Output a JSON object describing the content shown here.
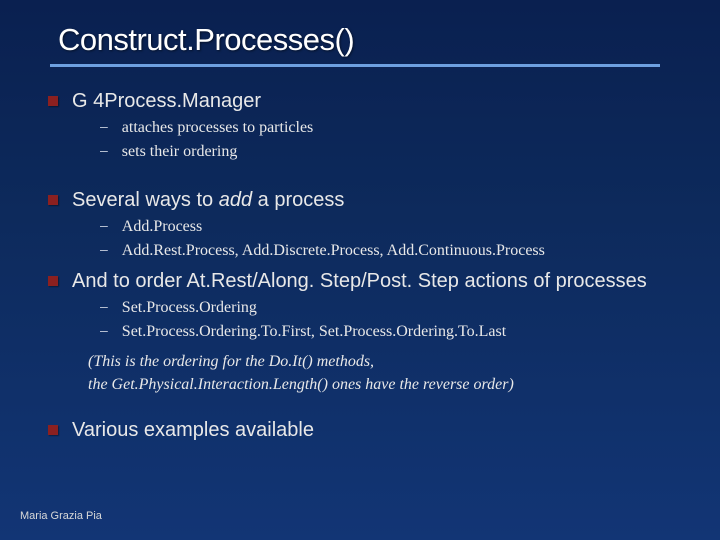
{
  "title": "Construct.Processes()",
  "bullets": [
    {
      "text": "G 4Process.Manager",
      "sub": [
        "attaches processes to particles",
        "sets their ordering"
      ]
    },
    {
      "text_prefix": "Several ways to ",
      "text_italic": "add",
      "text_suffix": " a process",
      "sub": [
        "Add.Process",
        "Add.Rest.Process, Add.Discrete.Process, Add.Continuous.Process"
      ]
    },
    {
      "text": "And to order At.Rest/Along. Step/Post. Step actions of processes",
      "sub": [
        "Set.Process.Ordering",
        "Set.Process.Ordering.To.First, Set.Process.Ordering.To.Last"
      ],
      "notes": [
        "(This is the ordering for the Do.It() methods,",
        "the Get.Physical.Interaction.Length() ones have the reverse order)"
      ]
    },
    {
      "text": "Various examples available"
    }
  ],
  "footer": "Maria Grazia Pia"
}
